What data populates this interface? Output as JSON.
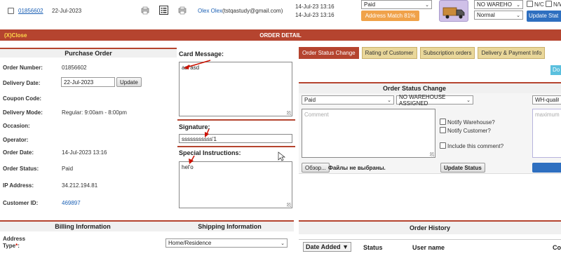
{
  "top_row": {
    "order_link": "01856602",
    "order_date": "22-Jul-2023",
    "customer": "Olex Olex",
    "customer_email": "(tstqastudy@gmail.com)",
    "date1": "14-Jul-23 13:16",
    "date2": "14-Jul-23 13:16",
    "status_select": "Paid",
    "address_match": "Address Match 81%",
    "warehouse_select": "NO WAREHO",
    "priority_select": "Normal",
    "nc_label": "N/C",
    "nw_label": "N/W",
    "update_status_btn": "Update Stat"
  },
  "order_bar": {
    "close": "(X)Close",
    "title": "ORDER DETAIL"
  },
  "purchase_order": {
    "title": "Purchase Order",
    "fields": [
      {
        "label": "Order Number:",
        "value": "01856602"
      },
      {
        "label": "Delivery Date:",
        "value": "22-Jul-2023"
      },
      {
        "label": "Coupon Code:",
        "value": ""
      },
      {
        "label": "Delivery Mode:",
        "value": "Regular: 9:00am - 8:00pm"
      },
      {
        "label": "Occasion:",
        "value": ""
      },
      {
        "label": "Operator:",
        "value": ""
      },
      {
        "label": "Order Date:",
        "value": "14-Jul-2023 13:16"
      },
      {
        "label": "Order Status:",
        "value": "Paid"
      },
      {
        "label": "IP Address:",
        "value": "34.212.194.81"
      },
      {
        "label": "Customer ID:",
        "value": "469897"
      }
    ],
    "update_btn": "Update"
  },
  "card_message": {
    "title": "Card Message:",
    "text": "asf'asd",
    "signature_label": "Signature:",
    "signature_value": "sssssssssss'1",
    "special_label": "Special Instructions:",
    "special_text": "hel'o"
  },
  "tabs": [
    "Order Status Change",
    "Rating of Customer",
    "Subscription orders",
    "Delivery & Payment Info"
  ],
  "do_btn": "Do",
  "status_change": {
    "title": "Order Status Change",
    "status_select": "Paid",
    "warehouse_select": "NO WAREHOUSE ASSIGNED",
    "wh_select": "WH-quality",
    "comment_placeholder": "Comment",
    "max_placeholder": "maximum le",
    "notify_warehouse": "Notify Warehouse?",
    "notify_customer": "Notify Customer?",
    "include_comment": "Include this comment?",
    "browse_btn": "Обзор...",
    "no_files": "Файлы не выбраны.",
    "update_status_btn": "Update Status"
  },
  "billing": {
    "title": "Billing Information",
    "address_type_label": "Address Type",
    "required": "*",
    "colon": ":"
  },
  "shipping": {
    "title": "Shipping Information",
    "address_type_select": "Home/Residence"
  },
  "order_history": {
    "title": "Order History",
    "columns": [
      "Date Added ▼",
      "Status",
      "User name",
      "Co"
    ]
  },
  "colors": {
    "brand_red": "#b5442f",
    "tab_gold": "#e9d79a",
    "address_match_orange": "#f0a24a",
    "update_blue": "#2e6fc0"
  }
}
